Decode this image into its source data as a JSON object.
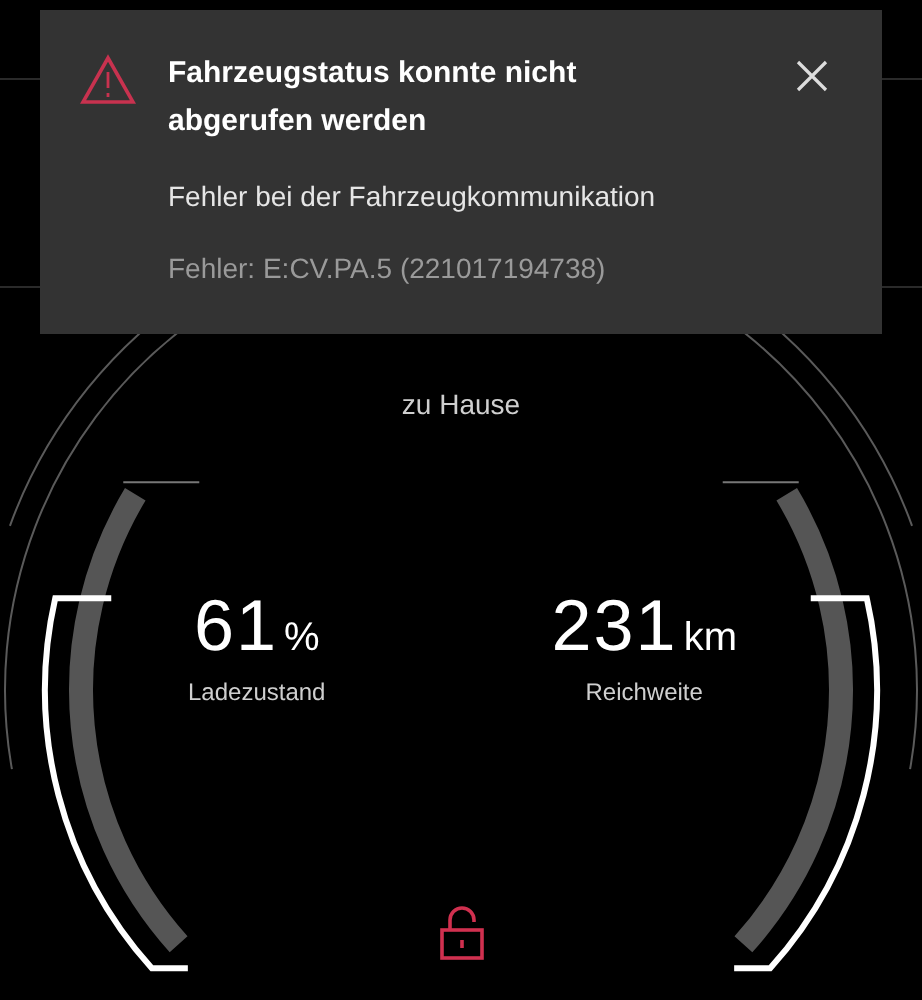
{
  "notification": {
    "title": "Fahrzeugstatus konnte nicht abgerufen werden",
    "message": "Fehler bei der Fahrzeugkommunikation",
    "error_code": "Fehler: E:CV.PA.5 (221017194738)"
  },
  "location": "zu Hause",
  "gauges": [
    {
      "value": "61",
      "unit": "%",
      "label": "Ladezustand"
    },
    {
      "value": "231",
      "unit": "km",
      "label": "Reichweite"
    }
  ],
  "lock": {
    "locked": false
  }
}
